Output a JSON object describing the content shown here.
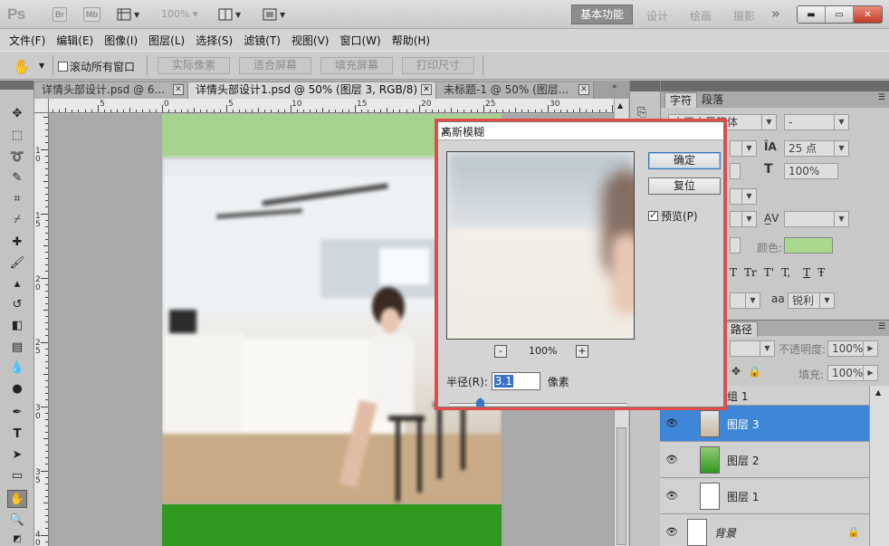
{
  "app": {
    "logo": "Ps",
    "chip_br": "Br",
    "chip_mb": "Mb",
    "zoom": "100%",
    "workspaces": {
      "active": "基本功能",
      "items": [
        "设计",
        "绘画",
        "摄影"
      ],
      "more": "»"
    },
    "window_buttons": {
      "minimize": "▬",
      "restore": "▭",
      "close": "✕"
    }
  },
  "menu": [
    "文件(F)",
    "编辑(E)",
    "图像(I)",
    "图层(L)",
    "选择(S)",
    "滤镜(T)",
    "视图(V)",
    "窗口(W)",
    "帮助(H)"
  ],
  "options": {
    "scroll_all_label": "滚动所有窗口",
    "buttons": [
      "实际像素",
      "适合屏幕",
      "填充屏幕",
      "打印尺寸"
    ]
  },
  "tabs": [
    {
      "label": "详情头部设计.psd @ 6...",
      "active": false
    },
    {
      "label": "详情头部设计1.psd @ 50% (图层 3, RGB/8) *",
      "active": true
    },
    {
      "label": "未标题-1 @ 50% (图层...",
      "active": false
    }
  ],
  "ruler": {
    "h_labels": [
      "5",
      "0",
      "5",
      "10",
      "15",
      "20",
      "25",
      "30"
    ],
    "v_labels": [
      "1\n0",
      "1\n5",
      "2\n0",
      "2\n5",
      "3\n0",
      "3\n5",
      "4\n0"
    ]
  },
  "dialog": {
    "title": "高斯模糊",
    "close": "×",
    "ok": "确定",
    "reset": "复位",
    "preview_label": "预览(P)",
    "preview_checked": true,
    "zoom_out": "-",
    "zoom_in": "+",
    "zoom_value": "100%",
    "radius_label": "半径(R):",
    "radius_value": "3.1",
    "radius_unit": "像素"
  },
  "char_panel": {
    "tabs": [
      "字符",
      "段落"
    ],
    "font_family": "方正大黑简体",
    "font_style": "-",
    "font_size": "25 点",
    "scale": "100%",
    "color_label": "颜色:",
    "color": "#a8d98e",
    "aa_label": "aa",
    "aa_value": "锐利",
    "type_styles": [
      "T",
      "Tr",
      "T'",
      "T,",
      "T",
      "Ŧ"
    ]
  },
  "layers_panel": {
    "tab": "路径",
    "opacity_label": "不透明度:",
    "opacity": "100%",
    "fill_label": "填充:",
    "fill": "100%",
    "group_label": "组 1",
    "layers": [
      {
        "name": "图层 3",
        "selected": true
      },
      {
        "name": "图层 2",
        "selected": false
      },
      {
        "name": "图层 1",
        "selected": false
      },
      {
        "name": "背景",
        "selected": false
      }
    ]
  }
}
